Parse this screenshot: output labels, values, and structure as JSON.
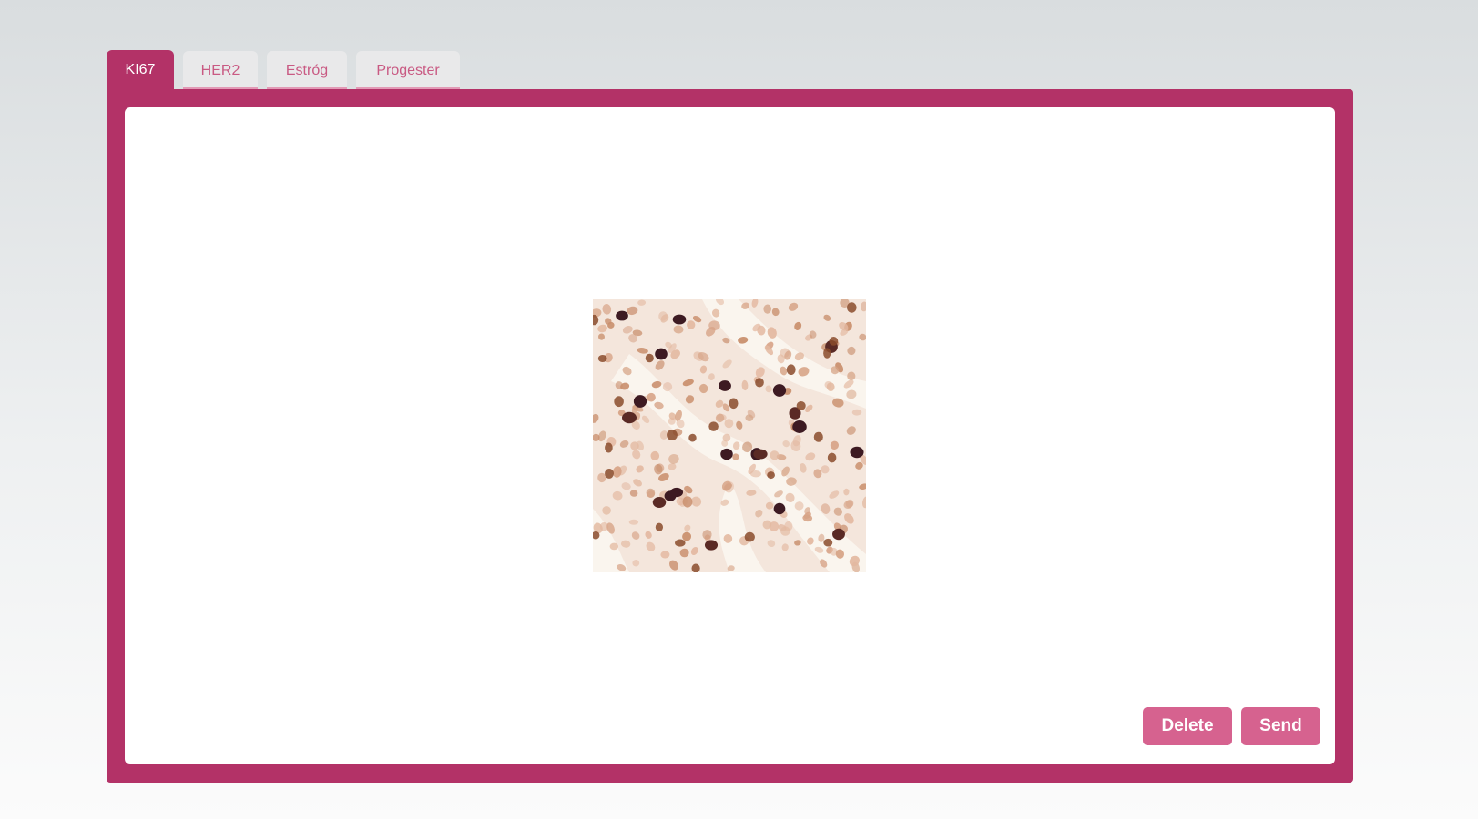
{
  "tabs": [
    {
      "label": "KI67",
      "active": true
    },
    {
      "label": "HER2",
      "active": false
    },
    {
      "label": "Estróg",
      "active": false
    },
    {
      "label": "Progester",
      "active": false
    }
  ],
  "image": {
    "description_icon": "microscopy-image"
  },
  "actions": {
    "delete_label": "Delete",
    "send_label": "Send"
  },
  "colors": {
    "accent": "#b33267",
    "button": "#d6628f",
    "tab_inactive_text": "#c95a83"
  }
}
